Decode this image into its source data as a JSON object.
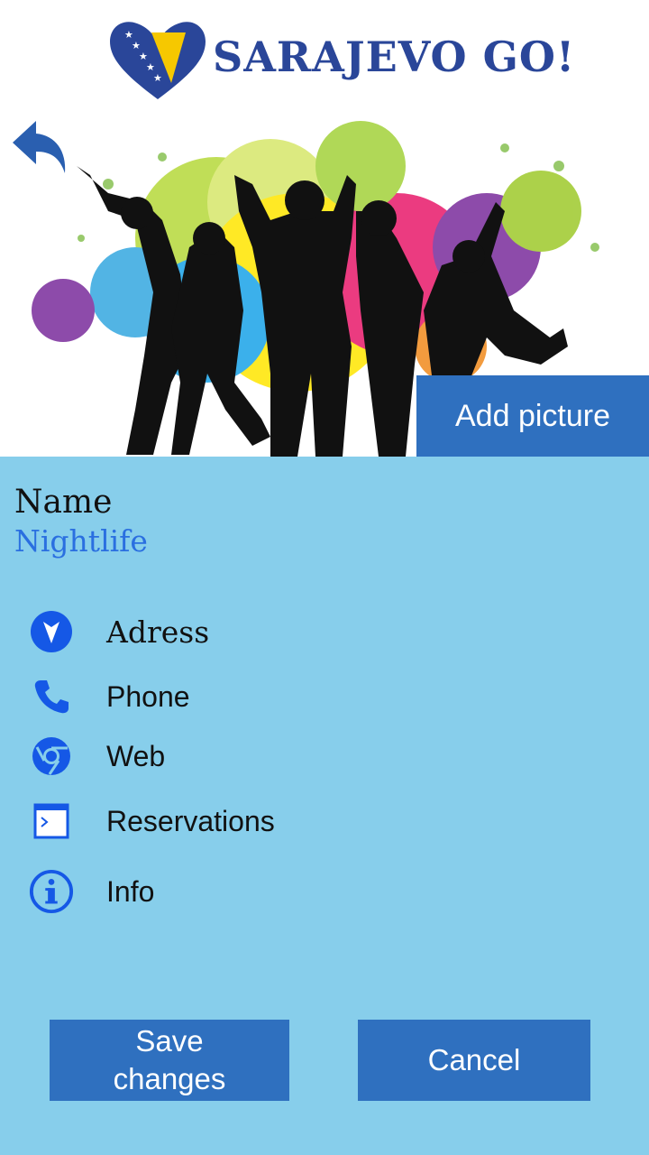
{
  "header": {
    "logo_text": "SARAJEVO GO!"
  },
  "banner": {
    "add_picture_label": "Add picture"
  },
  "place": {
    "name_label": "Name",
    "name_value": "Nightlife"
  },
  "details": [
    {
      "label": "Adress",
      "icon": "location-arrow-icon"
    },
    {
      "label": "Phone",
      "icon": "phone-icon"
    },
    {
      "label": "Web",
      "icon": "browser-icon"
    },
    {
      "label": "Reservations",
      "icon": "terminal-window-icon"
    },
    {
      "label": "Info",
      "icon": "info-icon"
    }
  ],
  "actions": {
    "save_line1": "Save",
    "save_line2": "changes",
    "cancel_label": "Cancel"
  },
  "colors": {
    "accent": "#2f70bf",
    "background": "#87ceeb",
    "icon": "#1558e6",
    "link": "#2a6fe0",
    "logo": "#2a4699"
  }
}
